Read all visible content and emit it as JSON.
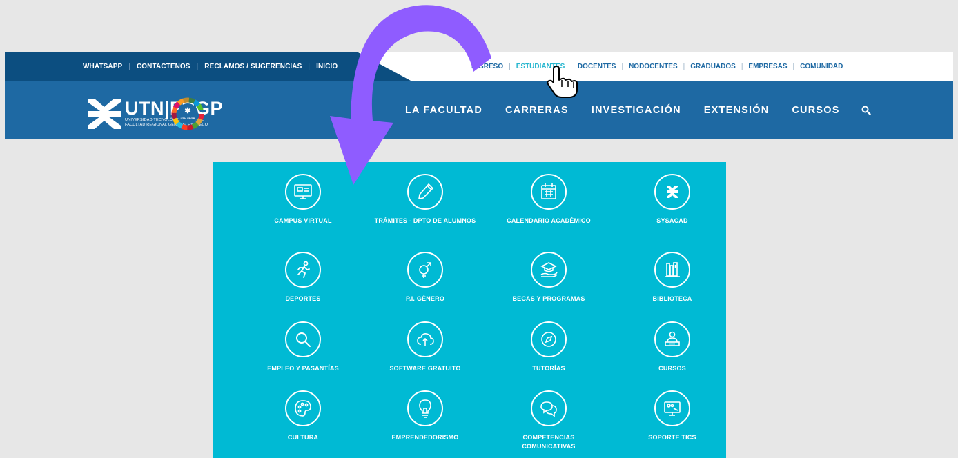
{
  "topbar": {
    "util_links": [
      "WHATSAPP",
      "CONTACTENOS",
      "RECLAMOS / SUGERENCIAS",
      "INICIO"
    ],
    "audience_links": [
      "INGRESO",
      "ESTUDIANTES",
      "DOCENTES",
      "NODOCENTES",
      "GRADUADOS",
      "EMPRESAS",
      "COMUNIDAD"
    ],
    "active": "ESTUDIANTES"
  },
  "logo": {
    "title": "UTN|FRGP",
    "sub1": "UNIVERSIDAD TECNOLÓGICA NACIONAL",
    "sub2": "FACULTAD REGIONAL GENERAL PACHECO",
    "badge_text": "UTN-FRGP"
  },
  "main_nav": [
    "LA FACULTAD",
    "CARRERAS",
    "INVESTIGACIÓN",
    "EXTENSIÓN",
    "CURSOS"
  ],
  "colors": {
    "header_blue": "#1e69a3",
    "topbar_dark": "#0c4e80",
    "panel_cyan": "#00bad4",
    "arrow_purple": "#8f5cff",
    "active_link": "#26b6cf"
  },
  "tiles": [
    {
      "label": "CAMPUS VIRTUAL",
      "icon": "monitor-icon"
    },
    {
      "label": "TRÁMITES - DPTO DE ALUMNOS",
      "icon": "pen-icon"
    },
    {
      "label": "CALENDARIO ACADÉMICO",
      "icon": "calendar-icon"
    },
    {
      "label": "SYSACAD",
      "icon": "utn-logo-icon"
    },
    {
      "label": "DEPORTES",
      "icon": "runner-icon"
    },
    {
      "label": "P.I. GÉNERO",
      "icon": "gender-icon"
    },
    {
      "label": "BECAS Y PROGRAMAS",
      "icon": "graduation-hand-icon"
    },
    {
      "label": "BIBLIOTECA",
      "icon": "books-icon"
    },
    {
      "label": "EMPLEO Y PASANTÍAS",
      "icon": "magnifier-icon"
    },
    {
      "label": "SOFTWARE GRATUITO",
      "icon": "cloud-upload-icon"
    },
    {
      "label": "TUTORÍAS",
      "icon": "compass-icon"
    },
    {
      "label": "CURSOS",
      "icon": "student-desk-icon"
    },
    {
      "label": "CULTURA",
      "icon": "palette-icon"
    },
    {
      "label": "EMPRENDEDORISMO",
      "icon": "lightbulb-icon"
    },
    {
      "label": "COMPETENCIAS COMUNICATIVAS",
      "icon": "speech-bubbles-icon"
    },
    {
      "label": "SOPORTE TICS",
      "icon": "screen-tools-icon"
    }
  ]
}
